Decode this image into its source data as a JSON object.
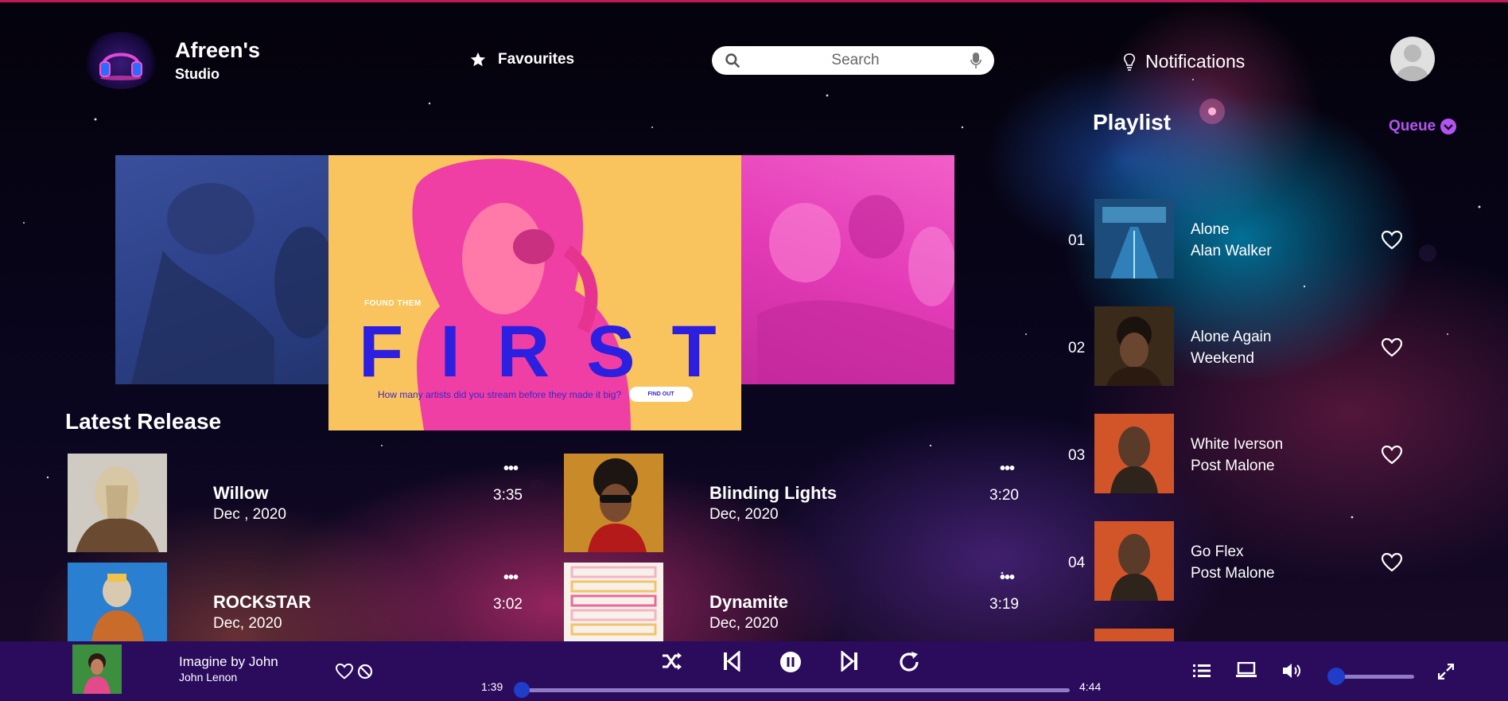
{
  "brand": {
    "name": "Afreen's",
    "sub": "Studio"
  },
  "nav": {
    "favourites_label": "Favourites",
    "notifications_label": "Notifications"
  },
  "search": {
    "placeholder": "Search"
  },
  "banner": {
    "kicker": "FOUND THEM",
    "headline": "FIRST",
    "question": "How many artists did you stream before they made it big?",
    "cta": "FIND OUT"
  },
  "latest": {
    "title": "Latest Release",
    "items": [
      {
        "title": "Willow",
        "date": "Dec , 2020",
        "duration": "3:35",
        "more": "•••"
      },
      {
        "title": "Blinding Lights",
        "date": "Dec, 2020",
        "duration": "3:20",
        "more": "•••"
      },
      {
        "title": "ROCKSTAR",
        "date": "Dec, 2020",
        "duration": "3:02",
        "more": "•••"
      },
      {
        "title": "Dynamite",
        "date": "Dec, 2020",
        "duration": "3:19",
        "more": "•••"
      }
    ]
  },
  "playlist": {
    "title": "Playlist",
    "queue_label": "Queue",
    "items": [
      {
        "num": "01",
        "song": "Alone",
        "artist": "Alan Walker"
      },
      {
        "num": "02",
        "song": "Alone Again",
        "artist": "Weekend"
      },
      {
        "num": "03",
        "song": "White Iverson",
        "artist": "Post Malone"
      },
      {
        "num": "04",
        "song": "Go Flex",
        "artist": "Post Malone"
      }
    ]
  },
  "player": {
    "title": "Imagine by John",
    "artist": "John Lenon",
    "current_time": "1:39",
    "total_time": "4:44",
    "progress": 0.0,
    "volume": 0.0
  },
  "colors": {
    "accent": "#b453f0",
    "player_bg": "#2a0b5c",
    "knob": "#1f3dc9",
    "banner_text": "#2d1fe0"
  },
  "icons": {
    "favourites": "star-icon",
    "search": "search-icon",
    "mic": "mic-icon",
    "notifications": "lightbulb-icon",
    "queue": "chevron-down-circle-icon",
    "like": "heart-icon",
    "ban": "ban-icon",
    "shuffle": "shuffle-icon",
    "prev": "skip-back-icon",
    "pause": "pause-icon",
    "next": "skip-forward-icon",
    "repeat": "repeat-icon",
    "list": "list-icon",
    "device": "laptop-icon",
    "volume": "volume-icon",
    "expand": "expand-icon"
  }
}
